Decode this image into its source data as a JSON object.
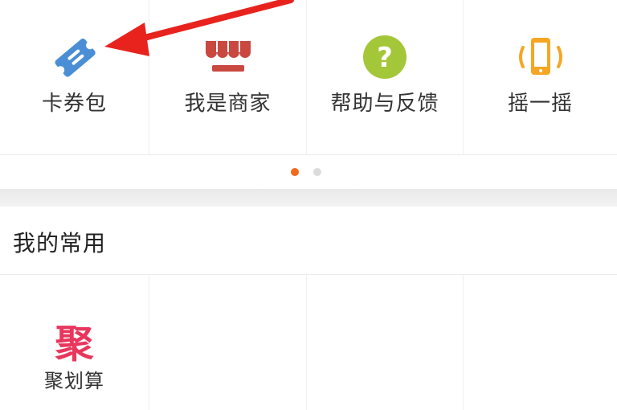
{
  "top_items": [
    {
      "label": "卡券包",
      "icon": "ticket-icon"
    },
    {
      "label": "我是商家",
      "icon": "shop-awning-icon"
    },
    {
      "label": "帮助与反馈",
      "icon": "help-question-icon"
    },
    {
      "label": "摇一摇",
      "icon": "phone-shake-icon"
    }
  ],
  "pager": {
    "total": 2,
    "active": 1
  },
  "section": {
    "title": "我的常用"
  },
  "favorites": [
    {
      "glyph": "聚",
      "label": "聚划算"
    }
  ],
  "colors": {
    "ticket": "#4a8fd6",
    "shop": "#c9483f",
    "help": "#a4c639",
    "phone": "#f5a623",
    "pager_active": "#f26b1d",
    "favorite_glyph": "#e8365d",
    "annotation_arrow": "#e8231e"
  }
}
